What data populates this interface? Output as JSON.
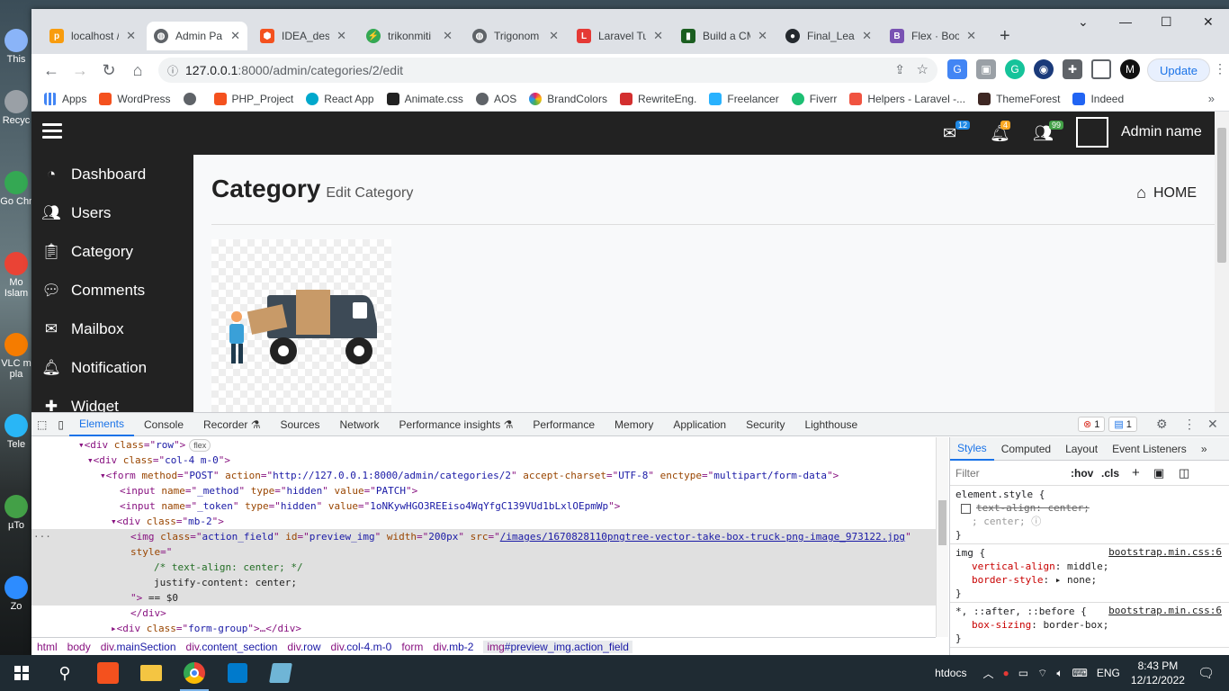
{
  "desktop": {
    "icons": [
      "This",
      "Recyc",
      "Go Chr",
      "Mo Islam",
      "VLC m pla",
      "Tele",
      "µTo",
      "Zo"
    ]
  },
  "browser": {
    "tabs": [
      {
        "title": "localhost /",
        "color": "#f89c0e"
      },
      {
        "title": "Admin Pa",
        "color": "#5f6368"
      },
      {
        "title": "IDEA_desi",
        "color": "#f4511e"
      },
      {
        "title": "trikonmiti",
        "color": "#34a853"
      },
      {
        "title": "Trigonom",
        "color": "#5f6368"
      },
      {
        "title": "Laravel Tu",
        "color": "#e53935"
      },
      {
        "title": "Build a CM",
        "color": "#1b5e20"
      },
      {
        "title": "Final_Lear",
        "color": "#24292e"
      },
      {
        "title": "Flex · Boo",
        "color": "#7952b3"
      }
    ],
    "new_tab": "+",
    "url_prefix": "127.0.0.1",
    "url_rest": ":8000/admin/categories/2/edit",
    "update_label": "Update",
    "bookmarks": [
      {
        "label": "Apps",
        "color": "#4285f4"
      },
      {
        "label": "WordPress",
        "color": "#f4511e"
      },
      {
        "label": "PHP_Project",
        "color": "#f4511e"
      },
      {
        "label": "React App",
        "color": "#00a8cc"
      },
      {
        "label": "Animate.css",
        "color": "#222"
      },
      {
        "label": "AOS",
        "color": "#5f6368"
      },
      {
        "label": "BrandColors",
        "color": "#e91e63"
      },
      {
        "label": "RewriteEng.",
        "color": "#d32f2f"
      },
      {
        "label": "Freelancer",
        "color": "#29b2fe"
      },
      {
        "label": "Fiverr",
        "color": "#1dbf73"
      },
      {
        "label": "Helpers - Laravel -...",
        "color": "#f05340"
      },
      {
        "label": "ThemeForest",
        "color": "#3e2723"
      },
      {
        "label": "Indeed",
        "color": "#2164f3"
      }
    ]
  },
  "app": {
    "badges": {
      "mail": "12",
      "bell": "4",
      "users": "99"
    },
    "admin_name": "Admin name",
    "sidebar": [
      "Dashboard",
      "Users",
      "Category",
      "Comments",
      "Mailbox",
      "Notification",
      "Widget"
    ],
    "title": "Category",
    "subtitle": "Edit Category",
    "home": "HOME"
  },
  "devtools": {
    "tabs": [
      "Elements",
      "Console",
      "Recorder ⚗",
      "Sources",
      "Network",
      "Performance insights ⚗",
      "Performance",
      "Memory",
      "Application",
      "Security",
      "Lighthouse"
    ],
    "errors": "1",
    "messages": "1",
    "lines": [
      {
        "indent": 52,
        "parts": [
          [
            "t",
            "▾<div "
          ],
          [
            "a",
            "class"
          ],
          [
            "t",
            "=\""
          ],
          [
            "v",
            "row"
          ],
          [
            "t",
            "\">"
          ]
        ],
        "chip": "flex"
      },
      {
        "indent": 62,
        "parts": [
          [
            "t",
            "▾<div "
          ],
          [
            "a",
            "class"
          ],
          [
            "t",
            "=\""
          ],
          [
            "v",
            "col-4 m-0"
          ],
          [
            "t",
            "\">"
          ]
        ]
      },
      {
        "indent": 76,
        "parts": [
          [
            "t",
            "▾<form "
          ],
          [
            "a",
            "method"
          ],
          [
            "t",
            "=\""
          ],
          [
            "v",
            "POST"
          ],
          [
            "t",
            "\" "
          ],
          [
            "a",
            "action"
          ],
          [
            "t",
            "=\""
          ],
          [
            "v",
            "http://127.0.0.1:8000/admin/categories/2"
          ],
          [
            "t",
            "\" "
          ],
          [
            "a",
            "accept-charset"
          ],
          [
            "t",
            "=\""
          ],
          [
            "v",
            "UTF-8"
          ],
          [
            "t",
            "\" "
          ],
          [
            "a",
            "enctype"
          ],
          [
            "t",
            "=\""
          ],
          [
            "v",
            "multipart/form-data"
          ],
          [
            "t",
            "\">"
          ]
        ]
      },
      {
        "indent": 98,
        "parts": [
          [
            "t",
            "<input "
          ],
          [
            "a",
            "name"
          ],
          [
            "t",
            "=\""
          ],
          [
            "v",
            "_method"
          ],
          [
            "t",
            "\" "
          ],
          [
            "a",
            "type"
          ],
          [
            "t",
            "=\""
          ],
          [
            "v",
            "hidden"
          ],
          [
            "t",
            "\" "
          ],
          [
            "a",
            "value"
          ],
          [
            "t",
            "=\""
          ],
          [
            "v",
            "PATCH"
          ],
          [
            "t",
            "\">"
          ]
        ]
      },
      {
        "indent": 98,
        "parts": [
          [
            "t",
            "<input "
          ],
          [
            "a",
            "name"
          ],
          [
            "t",
            "=\""
          ],
          [
            "v",
            "_token"
          ],
          [
            "t",
            "\" "
          ],
          [
            "a",
            "type"
          ],
          [
            "t",
            "=\""
          ],
          [
            "v",
            "hidden"
          ],
          [
            "t",
            "\" "
          ],
          [
            "a",
            "value"
          ],
          [
            "t",
            "=\""
          ],
          [
            "v",
            "1oNKywHGO3REEiso4WqYfgC139VUd1bLxlOEpmWp"
          ],
          [
            "t",
            "\">"
          ]
        ]
      },
      {
        "indent": 88,
        "parts": [
          [
            "t",
            "▾<div "
          ],
          [
            "a",
            "class"
          ],
          [
            "t",
            "=\""
          ],
          [
            "v",
            "mb-2"
          ],
          [
            "t",
            "\">"
          ]
        ]
      },
      {
        "indent": 110,
        "hl": true,
        "parts": [
          [
            "t",
            "<img "
          ],
          [
            "a",
            "class"
          ],
          [
            "t",
            "=\""
          ],
          [
            "v",
            "action_field"
          ],
          [
            "t",
            "\" "
          ],
          [
            "a",
            "id"
          ],
          [
            "t",
            "=\""
          ],
          [
            "v",
            "preview_img"
          ],
          [
            "t",
            "\" "
          ],
          [
            "a",
            "width"
          ],
          [
            "t",
            "=\""
          ],
          [
            "v",
            "200px"
          ],
          [
            "t",
            "\" "
          ],
          [
            "a",
            "src"
          ],
          [
            "t",
            "=\""
          ],
          [
            "l",
            "/images/1670828110pngtree-vector-take-box-truck-png-image_973122.jpg"
          ],
          [
            "t",
            "\""
          ]
        ]
      },
      {
        "indent": 110,
        "hl": true,
        "parts": [
          [
            "a",
            "style"
          ],
          [
            "t",
            "=\""
          ]
        ]
      },
      {
        "indent": 136,
        "hl": true,
        "parts": [
          [
            "c",
            "/* text-align: center; */"
          ]
        ]
      },
      {
        "indent": 136,
        "hl": true,
        "parts": [
          [
            "x",
            "justify-content: center;"
          ]
        ]
      },
      {
        "indent": 110,
        "hl": true,
        "parts": [
          [
            "t",
            "\">"
          ],
          [
            "x",
            " == $0"
          ]
        ]
      },
      {
        "indent": 110,
        "parts": [
          [
            "t",
            "</div>"
          ]
        ]
      },
      {
        "indent": 88,
        "parts": [
          [
            "t",
            "▸<div "
          ],
          [
            "a",
            "class"
          ],
          [
            "t",
            "=\""
          ],
          [
            "v",
            "form-group"
          ],
          [
            "t",
            "\">…</div>"
          ]
        ]
      }
    ],
    "crumbs": [
      {
        "tag": "html",
        "cls": ""
      },
      {
        "tag": "body",
        "cls": ""
      },
      {
        "tag": "div",
        "cls": ".mainSection"
      },
      {
        "tag": "div",
        "cls": ".content_section"
      },
      {
        "tag": "div",
        "cls": ".row"
      },
      {
        "tag": "div",
        "cls": ".col-4.m-0"
      },
      {
        "tag": "form",
        "cls": ""
      },
      {
        "tag": "div",
        "cls": ".mb-2"
      },
      {
        "tag": "img",
        "cls": "#preview_img.action_field"
      }
    ],
    "styles_tabs": [
      "Styles",
      "Computed",
      "Layout",
      "Event Listeners",
      "»"
    ],
    "filter_placeholder": "Filter",
    "hov": ":hov",
    "cls": ".cls",
    "element_style": "element.style {",
    "strike_prop": "text-align: center;",
    "ghost_val": "; center;",
    "img_rule": "img {",
    "img_src": "bootstrap.min.css:6",
    "img_props": [
      [
        "vertical-align",
        "middle;"
      ],
      [
        "border-style",
        "▸ none;"
      ]
    ],
    "star_rule": "*, ::after, ::before {",
    "star_src": "bootstrap.min.css:6",
    "star_props": [
      [
        "box-sizing",
        "border-box;"
      ]
    ]
  },
  "taskbar": {
    "tray_label": "htdocs",
    "lang": "ENG",
    "time": "8:43 PM",
    "date": "12/12/2022"
  }
}
